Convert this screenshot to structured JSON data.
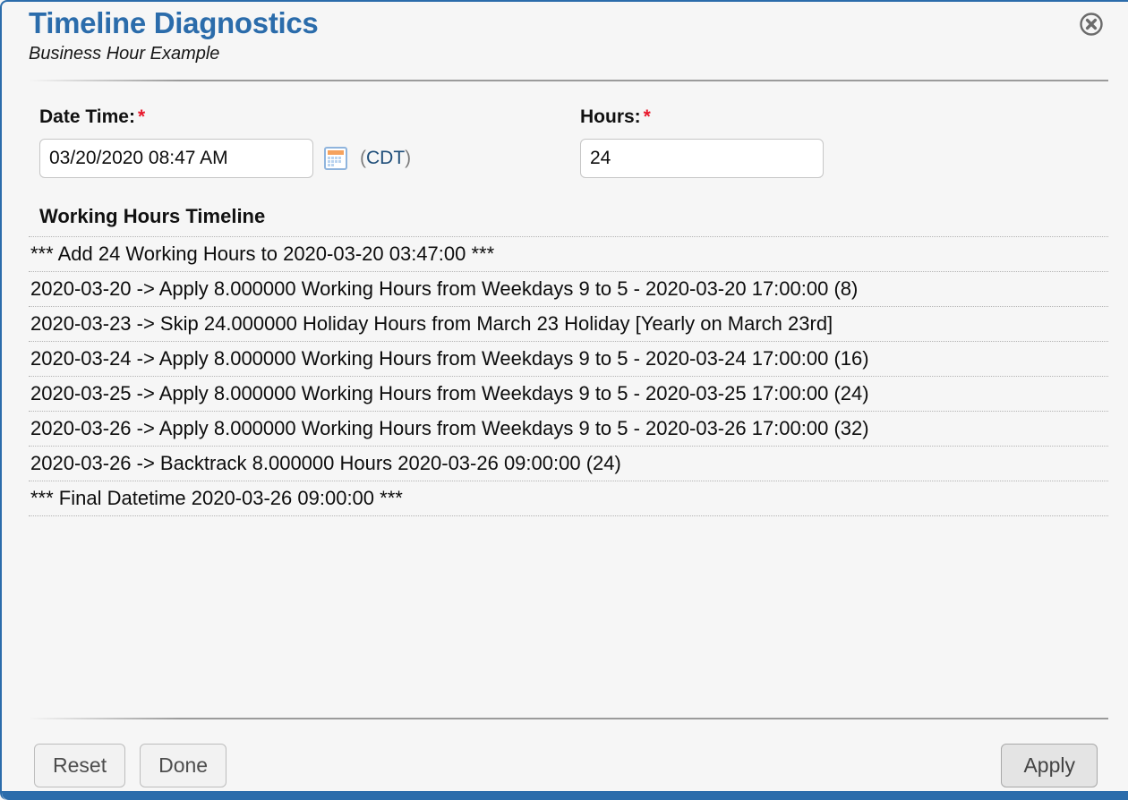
{
  "dialog": {
    "title": "Timeline Diagnostics",
    "subtitle": "Business Hour Example",
    "close_label": "×",
    "accent_color": "#2b6cab",
    "background_color": "#f6f6f6",
    "required_marker": "*"
  },
  "form": {
    "datetime": {
      "label": "Date Time:",
      "value": "03/20/2020 08:47 AM",
      "placeholder": "",
      "calendar_icon": "calendar-icon",
      "timezone_open": "(",
      "timezone": "CDT",
      "timezone_close": ")"
    },
    "hours": {
      "label": "Hours:",
      "value": "24",
      "placeholder": ""
    }
  },
  "timeline": {
    "title": "Working Hours Timeline",
    "rows": [
      "*** Add 24 Working Hours to 2020-03-20 03:47:00 ***",
      "2020-03-20 -> Apply 8.000000 Working Hours from Weekdays 9 to 5 - 2020-03-20 17:00:00 (8)",
      "2020-03-23 -> Skip 24.000000 Holiday Hours from March 23 Holiday [Yearly on March 23rd]",
      "2020-03-24 -> Apply 8.000000 Working Hours from Weekdays 9 to 5 - 2020-03-24 17:00:00 (16)",
      "2020-03-25 -> Apply 8.000000 Working Hours from Weekdays 9 to 5 - 2020-03-25 17:00:00 (24)",
      "2020-03-26 -> Apply 8.000000 Working Hours from Weekdays 9 to 5 - 2020-03-26 17:00:00 (32)",
      "2020-03-26 -> Backtrack 8.000000 Hours 2020-03-26 09:00:00 (24)",
      "*** Final Datetime 2020-03-26 09:00:00 ***"
    ]
  },
  "footer": {
    "reset_label": "Reset",
    "done_label": "Done",
    "apply_label": "Apply"
  }
}
